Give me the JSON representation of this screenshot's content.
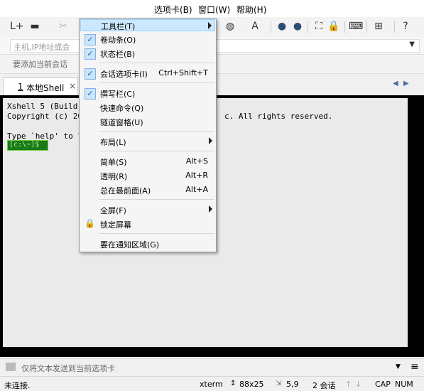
{
  "menubar": {
    "items": [
      "选项卡(B)",
      "窗口(W)",
      "帮助(H)"
    ]
  },
  "address": {
    "placeholder": "主机,IP地址或会"
  },
  "hint": {
    "text": "要添加当前会话"
  },
  "tabs": {
    "active_number": "1",
    "active_label": "本地Shell",
    "close": "×"
  },
  "terminal": {
    "line1": "Xshell 5 (Build ",
    "line2": "Copyright (c) 200",
    "line2_right": "c. All rights reserved.",
    "line3": "Type `help' to le",
    "prompt": "[c:\\~]$"
  },
  "compose": {
    "text": "仅将文本发送到当前选项卡"
  },
  "status": {
    "connection": "未连接.",
    "term": "xterm",
    "size": "88x25",
    "pos": "5,9",
    "sessions": "2 会话",
    "cap": "CAP",
    "num": "NUM"
  },
  "menu": {
    "toolbar_cut": "工具栏(T)",
    "scrollbar": "卷动条(O)",
    "statusbar": "状态栏(B)",
    "session_tabs": "会话选项卡(I)",
    "session_tabs_sc": "Ctrl+Shift+T",
    "compose": "撰写栏(C)",
    "quick_cmd": "快速命令(Q)",
    "tunnel": "隧道窗格(U)",
    "layout": "布局(L)",
    "simple": "简单(S)",
    "simple_sc": "Alt+S",
    "transparent": "透明(R)",
    "transparent_sc": "Alt+R",
    "always_top": "总在最前面(A)",
    "always_top_sc": "Alt+A",
    "fullscreen": "全屏(F)",
    "lock": "锁定屏幕",
    "notify": "要在通知区域(G)",
    "check": "✓"
  }
}
